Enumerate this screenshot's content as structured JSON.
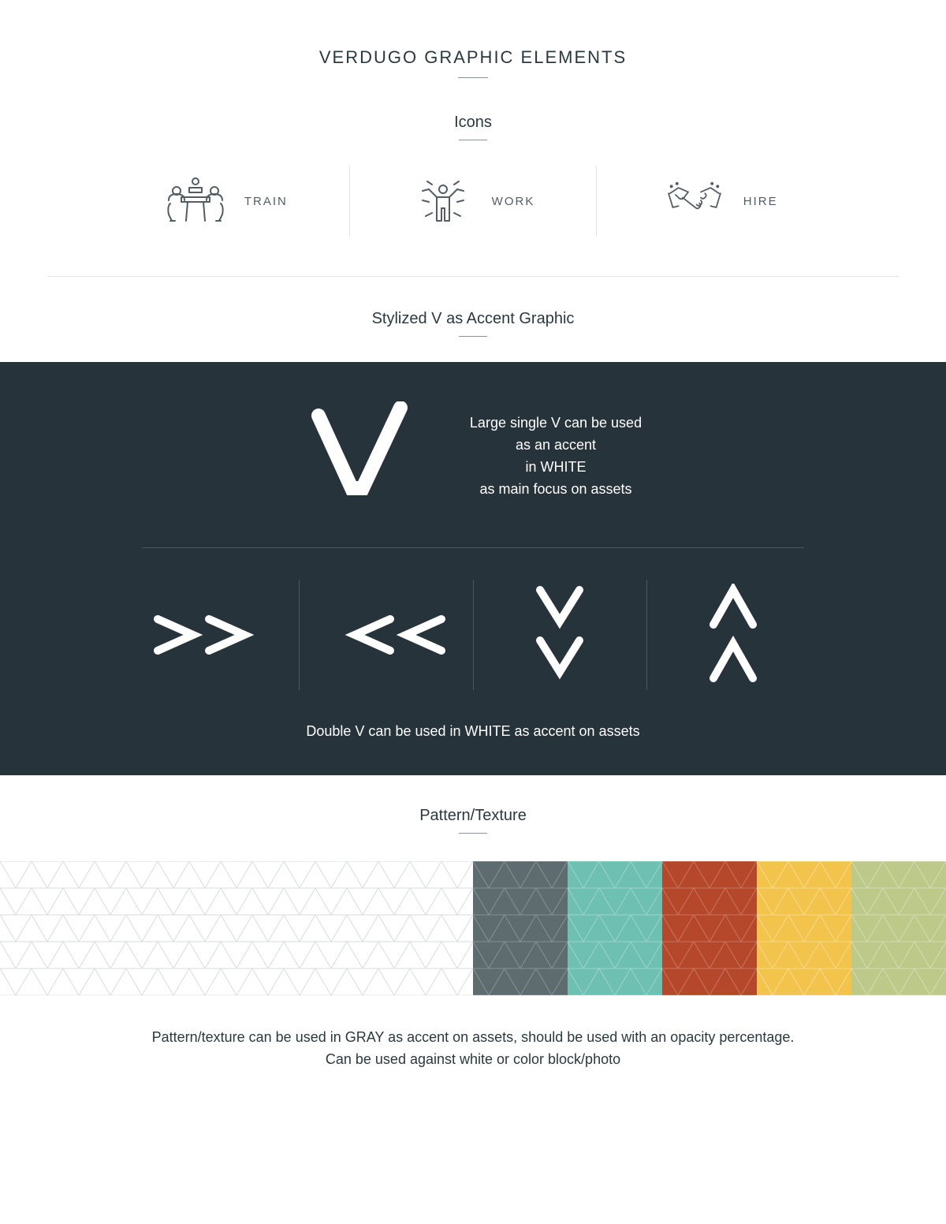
{
  "title": "VERDUGO GRAPHIC ELEMENTS",
  "sections": {
    "icons": {
      "heading": "Icons",
      "items": [
        {
          "label": "TRAIN"
        },
        {
          "label": "WORK"
        },
        {
          "label": "HIRE"
        }
      ]
    },
    "stylized_v": {
      "heading": "Stylized V as Accent Graphic",
      "large_caption_line1": "Large single V can be used",
      "large_caption_line2": "as an accent",
      "large_caption_line3": "in WHITE",
      "large_caption_line4": "as main focus on assets",
      "double_caption": "Double V can be used in WHITE as accent on assets"
    },
    "pattern": {
      "heading": "Pattern/Texture",
      "caption_line1": "Pattern/texture can be used in GRAY as accent on assets, should be used with an opacity percentage.",
      "caption_line2": "Can be used against white or color block/photo",
      "swatch_colors": {
        "white": "#ffffff",
        "slate": "#5e6c70",
        "teal": "#6ec0b3",
        "rust": "#b5472a",
        "yellow": "#f2c44c",
        "sage": "#bcc989"
      }
    }
  },
  "colors": {
    "dark_panel": "#27333a",
    "text": "#2a3940"
  }
}
